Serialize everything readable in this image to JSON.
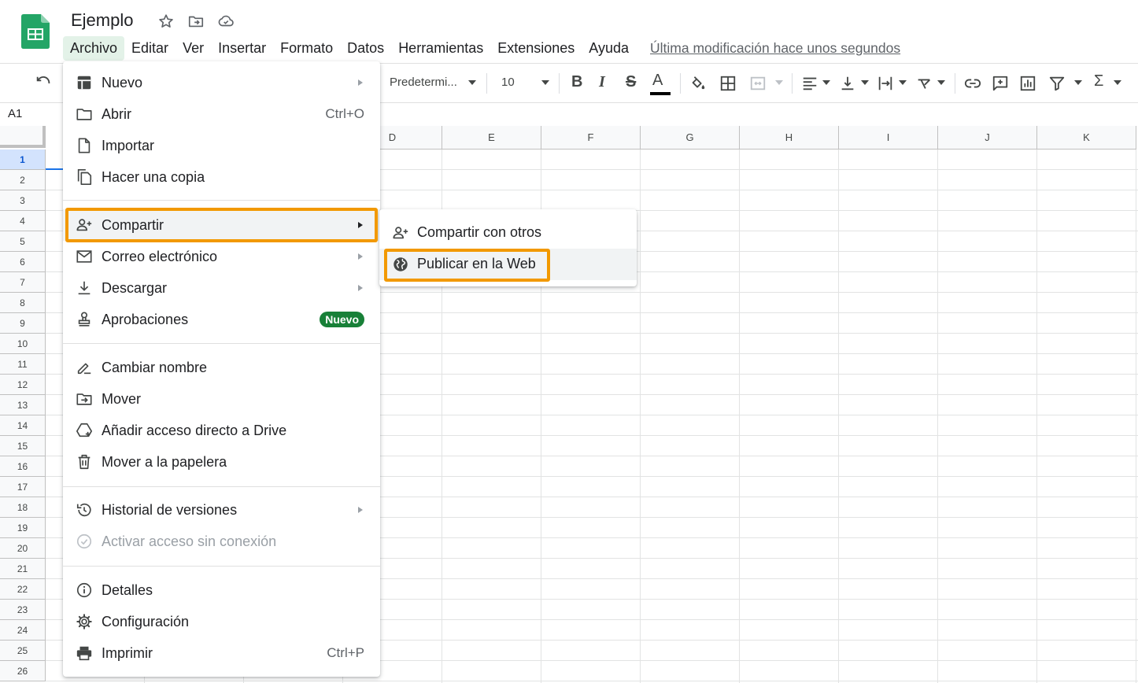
{
  "doc": {
    "title": "Ejemplo"
  },
  "menubar": {
    "items": [
      "Archivo",
      "Editar",
      "Ver",
      "Insertar",
      "Formato",
      "Datos",
      "Herramientas",
      "Extensiones",
      "Ayuda"
    ],
    "last_edit": "Última modificación hace unos segundos"
  },
  "toolbar": {
    "font": "Predetermi...",
    "font_size": "10",
    "bold": "B",
    "italic": "I",
    "strike": "S",
    "text_color_letter": "A",
    "sigma": "Σ"
  },
  "formula_bar": {
    "cell_ref": "A1"
  },
  "grid": {
    "columns": [
      "D",
      "E",
      "F",
      "G",
      "H",
      "I",
      "J",
      "K"
    ],
    "rows": [
      "1",
      "2",
      "3",
      "4",
      "5",
      "6",
      "7",
      "8",
      "9",
      "10",
      "11",
      "12",
      "13",
      "14",
      "15",
      "16",
      "17",
      "18",
      "19",
      "20",
      "21",
      "22",
      "23",
      "24",
      "25",
      "26"
    ]
  },
  "file_menu": {
    "nuevo": "Nuevo",
    "abrir": "Abrir",
    "abrir_shortcut": "Ctrl+O",
    "importar": "Importar",
    "hacer_copia": "Hacer una copia",
    "compartir": "Compartir",
    "correo": "Correo electrónico",
    "descargar": "Descargar",
    "aprobaciones": "Aprobaciones",
    "aprobaciones_badge": "Nuevo",
    "cambiar_nombre": "Cambiar nombre",
    "mover": "Mover",
    "acceso_directo": "Añadir acceso directo a Drive",
    "papelera": "Mover a la papelera",
    "historial": "Historial de versiones",
    "sin_conexion": "Activar acceso sin conexión",
    "detalles": "Detalles",
    "configuracion": "Configuración",
    "imprimir": "Imprimir",
    "imprimir_shortcut": "Ctrl+P"
  },
  "share_submenu": {
    "compartir_otros": "Compartir con otros",
    "publicar_web": "Publicar en la Web"
  },
  "colors": {
    "sheets_green": "#23a566",
    "highlight_orange": "#f29900",
    "badge_green": "#188038",
    "selection_blue": "#1a73e8"
  }
}
